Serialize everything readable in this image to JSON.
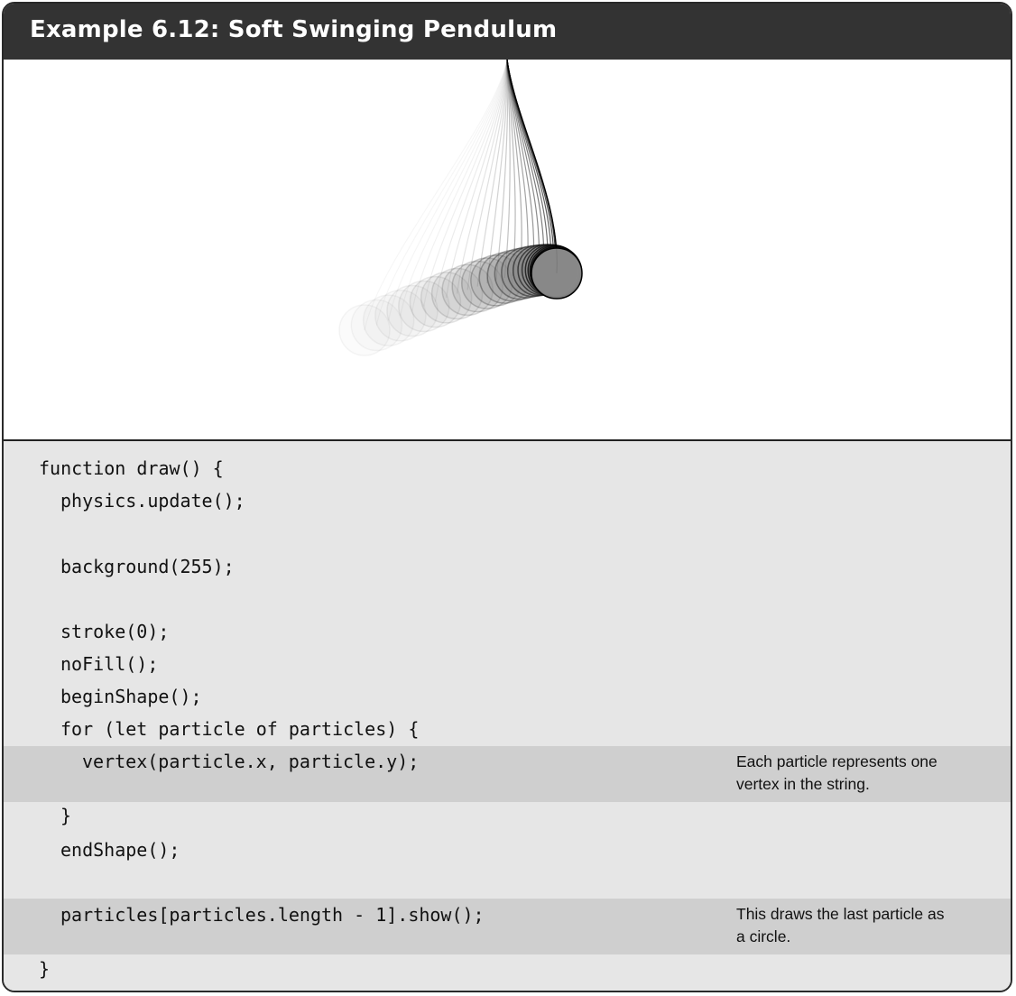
{
  "title": "Example 6.12: Soft Swinging Pendulum",
  "code_lines": [
    {
      "indent": 0,
      "text": "function draw() {"
    },
    {
      "indent": 1,
      "text": "physics.update();"
    },
    {
      "indent": 1,
      "text": ""
    },
    {
      "indent": 1,
      "text": "background(255);"
    },
    {
      "indent": 1,
      "text": ""
    },
    {
      "indent": 1,
      "text": "stroke(0);"
    },
    {
      "indent": 1,
      "text": "noFill();"
    },
    {
      "indent": 1,
      "text": "beginShape();"
    },
    {
      "indent": 1,
      "text": "for (let particle of particles) {"
    },
    {
      "indent": 2,
      "text": "vertex(particle.x, particle.y);"
    },
    {
      "indent": 1,
      "text": "}"
    },
    {
      "indent": 1,
      "text": "endShape();"
    },
    {
      "indent": 1,
      "text": ""
    },
    {
      "indent": 1,
      "text": "particles[particles.length - 1].show();"
    },
    {
      "indent": 0,
      "text": "}"
    }
  ],
  "annotations": [
    {
      "line": 9,
      "text_1": "Each particle represents one",
      "text_2": "vertex in the string."
    },
    {
      "line": 13,
      "text_1": "This draws the last particle as",
      "text_2": "a circle."
    }
  ],
  "colors": {
    "header_bg": "#333333",
    "code_bg": "#e6e6e6",
    "highlight_bg": "#cfcfcf",
    "bob_fill": "#888888"
  }
}
